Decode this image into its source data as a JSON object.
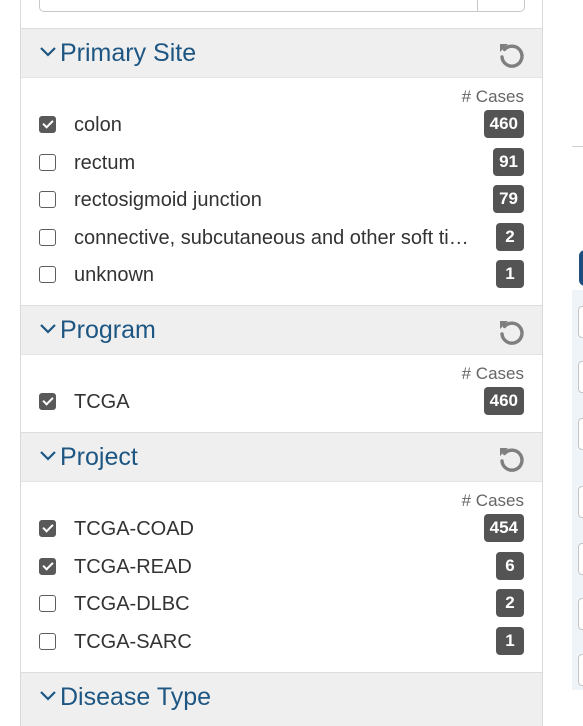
{
  "facets": [
    {
      "title": "Primary Site",
      "cases_label": "# Cases",
      "items": [
        {
          "label": "colon",
          "count": "460",
          "checked": true
        },
        {
          "label": "rectum",
          "count": "91",
          "checked": false
        },
        {
          "label": "rectosigmoid junction",
          "count": "79",
          "checked": false
        },
        {
          "label": "connective, subcutaneous and other soft ti…",
          "count": "2",
          "checked": false
        },
        {
          "label": "unknown",
          "count": "1",
          "checked": false
        }
      ]
    },
    {
      "title": "Program",
      "cases_label": "# Cases",
      "items": [
        {
          "label": "TCGA",
          "count": "460",
          "checked": true
        }
      ]
    },
    {
      "title": "Project",
      "cases_label": "# Cases",
      "items": [
        {
          "label": "TCGA-COAD",
          "count": "454",
          "checked": true
        },
        {
          "label": "TCGA-READ",
          "count": "6",
          "checked": true
        },
        {
          "label": "TCGA-DLBC",
          "count": "2",
          "checked": false
        },
        {
          "label": "TCGA-SARC",
          "count": "1",
          "checked": false
        }
      ]
    },
    {
      "title": "Disease Type"
    }
  ],
  "icons": {
    "collapse": "chevron-down-icon",
    "reset": "reset-icon"
  },
  "colors": {
    "title": "#1d5682",
    "badge": "#545454",
    "header_bg": "#efefef"
  }
}
